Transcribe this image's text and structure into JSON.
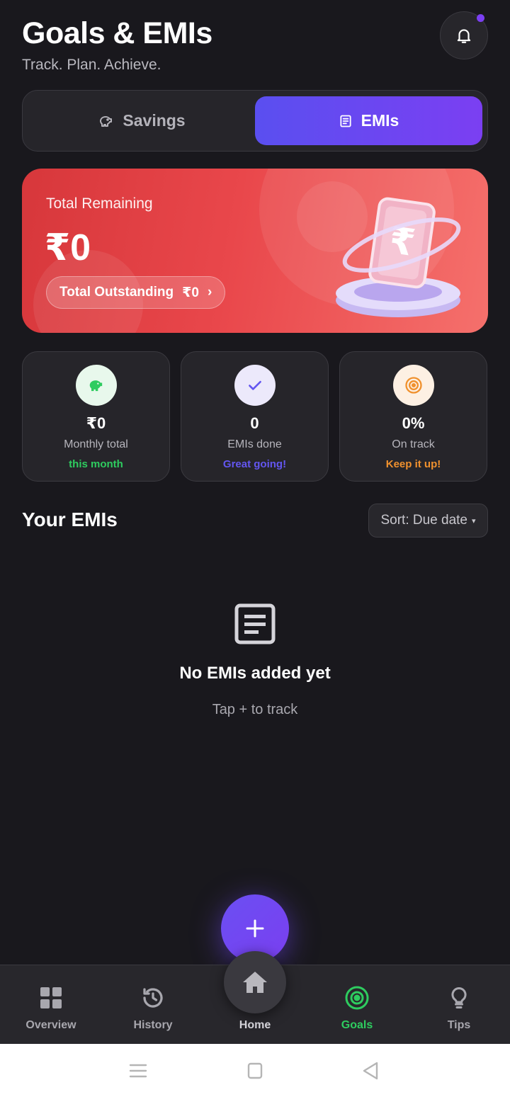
{
  "header": {
    "title": "Goals & EMIs",
    "subtitle": "Track. Plan. Achieve.",
    "notification_icon": "bell-icon",
    "notification_dot_color": "#7b3ff2"
  },
  "tabs": [
    {
      "label": "Savings",
      "icon": "piggy-bank-icon",
      "active": false
    },
    {
      "label": "EMIs",
      "icon": "document-list-icon",
      "active": true
    }
  ],
  "hero": {
    "label": "Total Remaining",
    "amount": "₹0",
    "outstanding_label": "Total Outstanding",
    "outstanding_value": "₹0",
    "chevron": "›",
    "illustration_glyph": "₹",
    "gradient_start": "#d7373b",
    "gradient_end": "#f5706c"
  },
  "stats": [
    {
      "icon": "piggy-bank-icon",
      "value": "₹0",
      "label": "Monthly total",
      "note": "this month",
      "note_color": "#2ecc5f"
    },
    {
      "icon": "check-icon",
      "value": "0",
      "label": "EMIs done",
      "note": "Great going!",
      "note_color": "#6356f0"
    },
    {
      "icon": "target-icon",
      "value": "0%",
      "label": "On track",
      "note": "Keep it up!",
      "note_color": "#f0912e"
    }
  ],
  "emis_section": {
    "title": "Your EMIs",
    "sort_label": "Sort: Due date",
    "sort_caret": "▾"
  },
  "empty_state": {
    "icon": "document-icon",
    "title": "No EMIs added yet",
    "subtitle": "Tap + to track"
  },
  "fab": {
    "icon": "plus-icon",
    "color": "#6b4ff3"
  },
  "bottom_nav": [
    {
      "label": "Overview",
      "icon": "grid-icon",
      "active": false
    },
    {
      "label": "History",
      "icon": "history-icon",
      "active": false
    },
    {
      "label": "Home",
      "icon": "home-icon",
      "active": false
    },
    {
      "label": "Goals",
      "icon": "target-icon",
      "active": true,
      "active_color": "#2ecc5f"
    },
    {
      "label": "Tips",
      "icon": "lightbulb-icon",
      "active": false
    }
  ]
}
